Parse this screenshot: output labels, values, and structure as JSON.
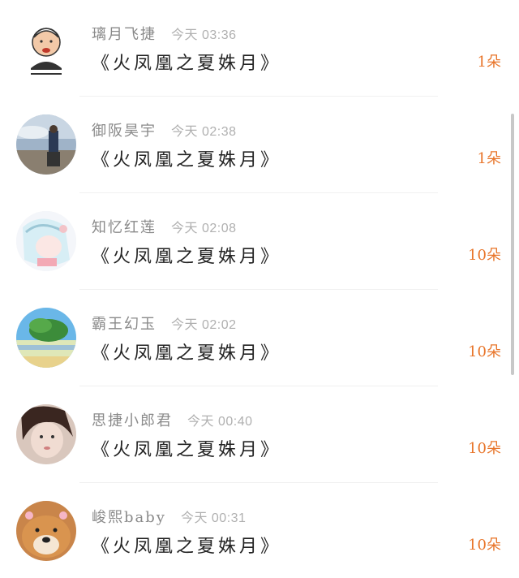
{
  "gift_list": [
    {
      "user": "璃月飞捷",
      "time": "今天 03:36",
      "gift": "《火凤凰之夏姝月》",
      "count": "1朵",
      "avatar": "cartoon-avatar"
    },
    {
      "user": "御阪昊宇",
      "time": "今天 02:38",
      "gift": "《火凤凰之夏姝月》",
      "count": "1朵",
      "avatar": "sky-photo-avatar"
    },
    {
      "user": "知忆红莲",
      "time": "今天 02:08",
      "gift": "《火凤凰之夏姝月》",
      "count": "10朵",
      "avatar": "anime-girl-avatar"
    },
    {
      "user": "霸王幻玉",
      "time": "今天 02:02",
      "gift": "《火凤凰之夏姝月》",
      "count": "10朵",
      "avatar": "landscape-avatar"
    },
    {
      "user": "思捷小郎君",
      "time": "今天 00:40",
      "gift": "《火凤凰之夏姝月》",
      "count": "10朵",
      "avatar": "girl-photo-avatar"
    },
    {
      "user": "峻熙baby",
      "time": "今天 00:31",
      "gift": "《火凤凰之夏姝月》",
      "count": "10朵",
      "avatar": "dog-avatar"
    }
  ],
  "colors": {
    "count": "#e8752a",
    "name": "#8a8a8a",
    "time": "#b0b0b0",
    "gift": "#222222"
  }
}
